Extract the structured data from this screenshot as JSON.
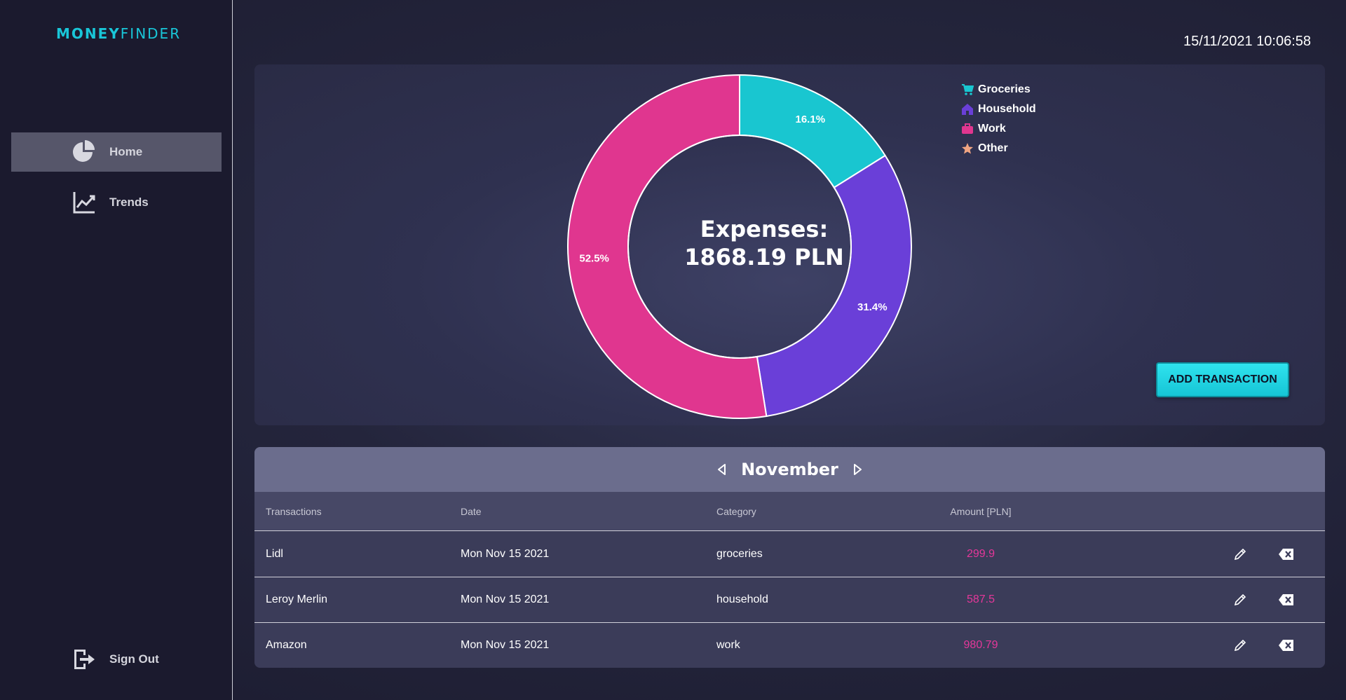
{
  "app": {
    "logo_bold": "MONEY",
    "logo_light": "FINDER"
  },
  "sidebar": {
    "items": [
      {
        "label": "Home",
        "icon": "pie-chart-icon",
        "active": true
      },
      {
        "label": "Trends",
        "icon": "trend-line-icon",
        "active": false
      }
    ],
    "signout_label": "Sign Out"
  },
  "header": {
    "datetime": "15/11/2021 10:06:58"
  },
  "summary": {
    "line1": "Expenses:",
    "line2": "1868.19 PLN"
  },
  "chart_data": {
    "type": "pie",
    "categories": [
      "Groceries",
      "Household",
      "Work",
      "Other"
    ],
    "values": [
      16.1,
      31.4,
      52.5,
      0
    ],
    "labels": [
      "16.1%",
      "31.4%",
      "52.5%",
      ""
    ],
    "colors": [
      "#19c6d0",
      "#6a3fd8",
      "#e0368f",
      "#f0a582"
    ],
    "legend": "top-right"
  },
  "add_button_label": "ADD TRANSACTION",
  "transactions": {
    "month": "November",
    "headers": [
      "Transactions",
      "Date",
      "Category",
      "Amount [PLN]"
    ],
    "rows": [
      {
        "name": "Lidl",
        "date": "Mon Nov 15 2021",
        "category": "groceries",
        "amount": "299.9"
      },
      {
        "name": "Leroy Merlin",
        "date": "Mon Nov 15 2021",
        "category": "household",
        "amount": "587.5"
      },
      {
        "name": "Amazon",
        "date": "Mon Nov 15 2021",
        "category": "work",
        "amount": "980.79"
      }
    ]
  },
  "colors": {
    "accent": "#19c6d8",
    "amount": "#e5379a",
    "sidebar_bg": "#1b1a2e"
  }
}
